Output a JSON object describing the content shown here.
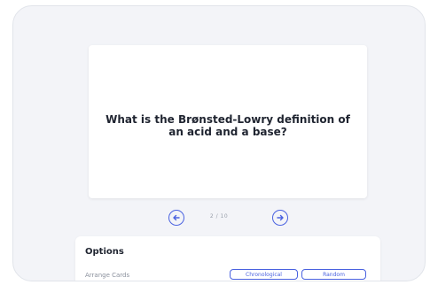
{
  "card": {
    "question": "What is the Brønsted-Lowry definition of an acid and a base?"
  },
  "navigation": {
    "counter": "2 / 10",
    "prev_icon": "arrow-left-circle-icon",
    "next_icon": "arrow-right-circle-icon"
  },
  "options": {
    "title": "Options",
    "arrange_label": "Arrange Cards",
    "buttons": [
      "Chronological",
      "Random"
    ]
  },
  "colors": {
    "accent": "#4a62e0",
    "panel_background": "#f3f4f8",
    "card_background": "#ffffff",
    "text_primary": "#1f2430",
    "text_muted": "#9aa0ab"
  }
}
